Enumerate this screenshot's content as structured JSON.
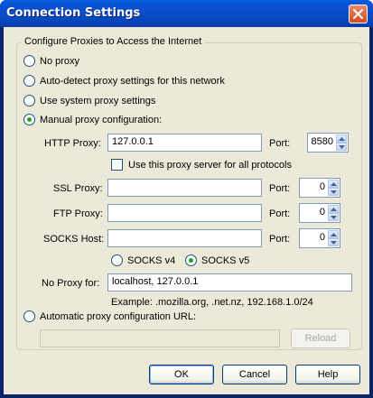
{
  "window": {
    "title": "Connection Settings"
  },
  "group": {
    "title": "Configure Proxies to Access the Internet"
  },
  "modes": {
    "no_proxy": "No proxy",
    "auto_detect": "Auto-detect proxy settings for this network",
    "system": "Use system proxy settings",
    "manual": "Manual proxy configuration:",
    "auto_url": "Automatic proxy configuration URL:",
    "selected": "manual"
  },
  "manual": {
    "http_label": "HTTP Proxy:",
    "http_value": "127.0.0.1",
    "http_port": "8580",
    "same_for_all": "Use this proxy server for all protocols",
    "ssl_label": "SSL Proxy:",
    "ssl_value": "",
    "ssl_port": "0",
    "ftp_label": "FTP Proxy:",
    "ftp_value": "",
    "ftp_port": "0",
    "socks_label": "SOCKS Host:",
    "socks_value": "",
    "socks_port": "0",
    "port_label": "Port:",
    "socks_v4": "SOCKS v4",
    "socks_v5": "SOCKS v5",
    "socks_selected": "v5",
    "no_proxy_label": "No Proxy for:",
    "no_proxy_value": "localhost, 127.0.0.1",
    "example": "Example: .mozilla.org, .net.nz, 192.168.1.0/24"
  },
  "auto_url": {
    "value": "",
    "reload": "Reload"
  },
  "buttons": {
    "ok": "OK",
    "cancel": "Cancel",
    "help": "Help"
  }
}
